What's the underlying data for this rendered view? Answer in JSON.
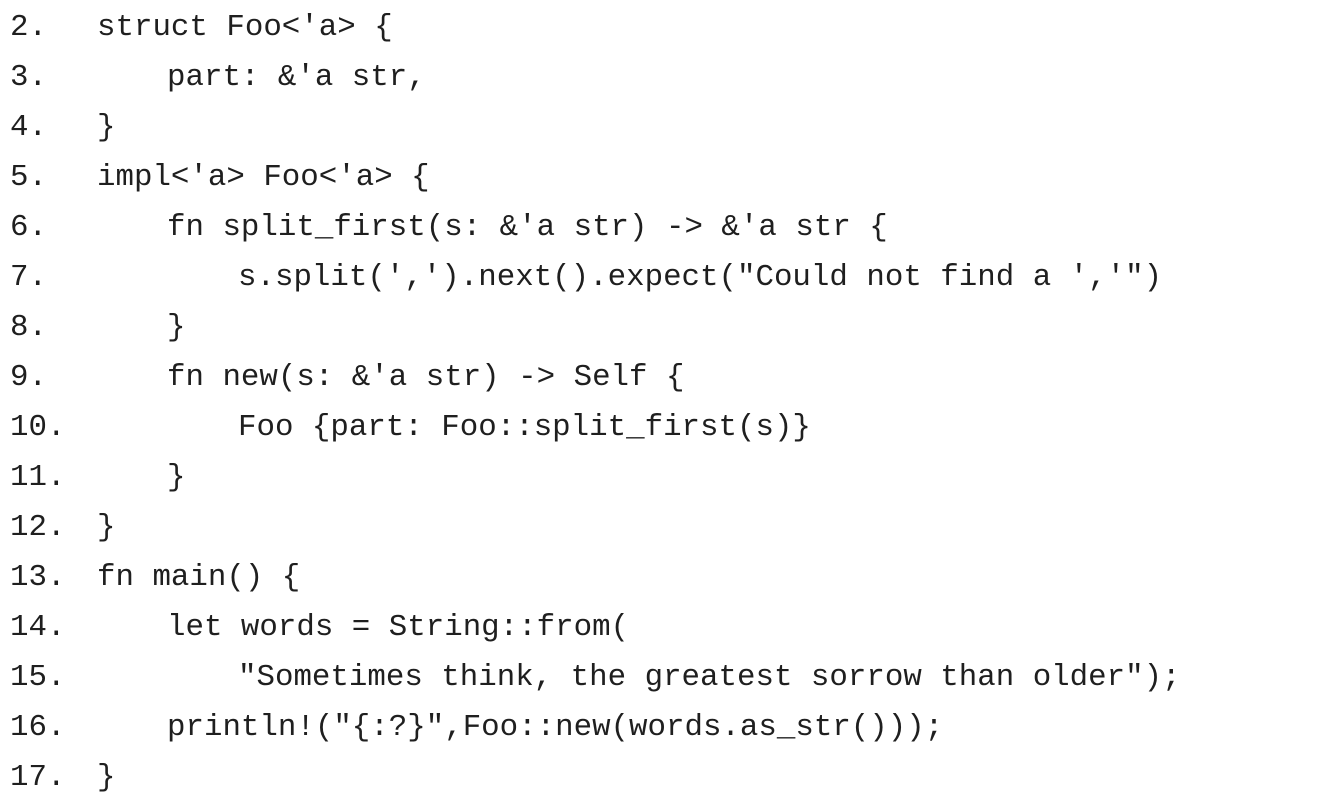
{
  "code_listing": {
    "lines": [
      {
        "number": "2.",
        "text": "struct Foo<'a> {"
      },
      {
        "number": "3.",
        "text": "part: &'a str,"
      },
      {
        "number": "4.",
        "text": "}"
      },
      {
        "number": "5.",
        "text": "impl<'a> Foo<'a> {"
      },
      {
        "number": "6.",
        "text": "fn split_first(s: &'a str) -> &'a str {"
      },
      {
        "number": "7.",
        "text": "s.split(',').next().expect(\"Could not find a ','\")"
      },
      {
        "number": "8.",
        "text": "}"
      },
      {
        "number": "9.",
        "text": "fn new(s: &'a str) -> Self {"
      },
      {
        "number": "10.",
        "text": "Foo {part: Foo::split_first(s)}"
      },
      {
        "number": "11.",
        "text": "}"
      },
      {
        "number": "12.",
        "text": "}"
      },
      {
        "number": "13.",
        "text": "fn main() {"
      },
      {
        "number": "14.",
        "text": "let words = String::from("
      },
      {
        "number": "15.",
        "text": "\"Sometimes think, the greatest sorrow than older\");"
      },
      {
        "number": "16.",
        "text": "println!(\"{:?}\",Foo::new(words.as_str()));"
      },
      {
        "number": "17.",
        "text": "}"
      }
    ]
  }
}
